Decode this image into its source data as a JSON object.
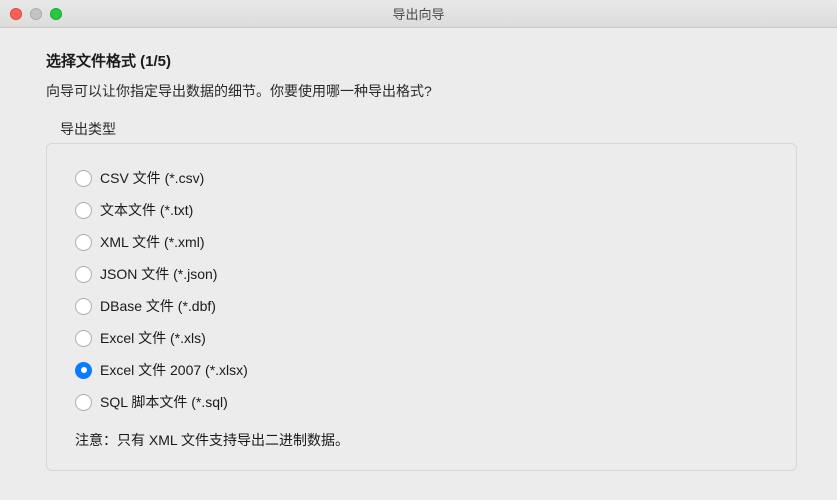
{
  "window": {
    "title": "导出向导"
  },
  "wizard": {
    "step_title": "选择文件格式 (1/5)",
    "step_desc": "向导可以让你指定导出数据的细节。你要使用哪一种导出格式?",
    "group_label": "导出类型",
    "note": "注意：只有 XML 文件支持导出二进制数据。",
    "options": [
      {
        "label": "CSV 文件 (*.csv)",
        "selected": false
      },
      {
        "label": "文本文件 (*.txt)",
        "selected": false
      },
      {
        "label": "XML 文件 (*.xml)",
        "selected": false
      },
      {
        "label": "JSON 文件 (*.json)",
        "selected": false
      },
      {
        "label": "DBase 文件 (*.dbf)",
        "selected": false
      },
      {
        "label": "Excel 文件 (*.xls)",
        "selected": false
      },
      {
        "label": "Excel 文件 2007 (*.xlsx)",
        "selected": true
      },
      {
        "label": "SQL 脚本文件 (*.sql)",
        "selected": false
      }
    ]
  }
}
